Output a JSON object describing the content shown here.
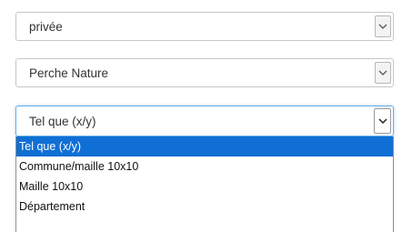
{
  "selects": [
    {
      "value": "privée",
      "icon": "chevron-down-icon"
    },
    {
      "value": "Perche Nature",
      "icon": "chevron-down-icon"
    },
    {
      "value": "Tel que (x/y)",
      "icon": "chevron-down-icon",
      "open": true
    }
  ],
  "dropdown": {
    "options": [
      {
        "label": "Tel que (x/y)",
        "selected": true
      },
      {
        "label": "Commune/maille 10x10"
      },
      {
        "label": "Maille 10x10"
      },
      {
        "label": "Département"
      }
    ]
  },
  "colors": {
    "selected_bg": "#0f6fd4",
    "focus_border": "#66afe9"
  }
}
